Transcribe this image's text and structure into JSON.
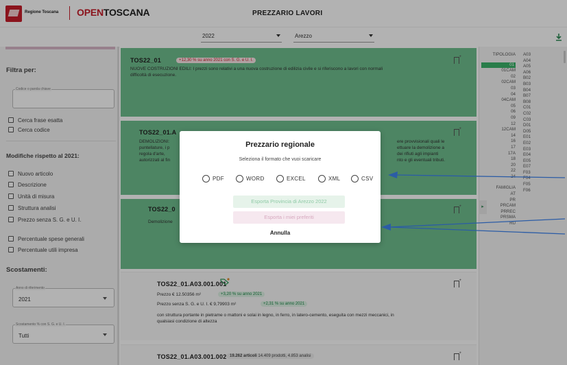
{
  "header": {
    "region": "Regione Toscana",
    "brand_open": "OPEN",
    "brand_tos": "TOSCANA",
    "title": "PREZZARIO LAVORI",
    "year": "2022",
    "province": "Arezzo",
    "download_icon": "download-icon"
  },
  "sidebar": {
    "filter_title": "Filtra per:",
    "search_legend": "Codice o parola chiave",
    "exact_phrase": "Cerca frase esatta",
    "search_code": "Cerca codice",
    "changes_title": "Modifiche rispetto al 2021:",
    "changes": [
      "Nuovo articolo",
      "Descrizione",
      "Unità di misura",
      "Struttura analisi",
      "Prezzo senza S. G. e U. I."
    ],
    "percent": [
      "Percentuale spese generali",
      "Percentuale utili impresa"
    ],
    "deviation_title": "Scostamenti:",
    "ref_year_legend": "Anno di riferimento",
    "ref_year": "2021",
    "deviation_legend": "Scostamento % con S. G. e U. I.",
    "deviation_value": "Tutti"
  },
  "cards": {
    "c1": {
      "code": "TOS22_01",
      "badge": "+12,30 % su anno 2021 con S. G. e U. I.",
      "desc1": "NUOVE COSTRUZIONI EDILI: I prezzi sono relativi a una nuova costruzione di edilizia civile e si riferiscono a lavori con normali",
      "desc2": "difficoltà di esecuzione."
    },
    "c2": {
      "code": "TOS22_01.A",
      "desc_left1": "DEMOLIZIONI:",
      "desc_left2": "puntellature, i p",
      "desc_left3": "regola d'arte, ",
      "desc_left4": "autorizzati al fin",
      "desc_right1": "ere provvisionali quali le",
      "desc_right2": "ettuare la demolizione a",
      "desc_right3": "dei rifiuti agli impianti",
      "desc_right4": "nto e gli eventuali tributi."
    },
    "c3": {
      "code": "TOS22_0",
      "desc": "Demolizione"
    },
    "c4": {
      "code": "TOS22_01.A03.001.001",
      "price": "Prezzo € 12.50356 m²",
      "price_badge": "+3,20 % su anno 2021",
      "price_no": "Prezzo senza S. G. e U. I. € 9,79903 m²",
      "price_no_badge": "+2,31 % su anno 2021",
      "desc1": "con struttura portante in pietrame o mattoni e solai in legno, in ferro, in latero-cemento, eseguita con mezzi meccanici, in",
      "desc2": "qualsiasi condizione di altezza"
    },
    "c5": {
      "code": "TOS22_01.A03.001.002",
      "badge_bold": "19.262 articoli",
      "badge_rest": "14.409 prodotti, 4.853 analisi"
    }
  },
  "rightpanel": {
    "tipologia_label": "TIPOLOGIA",
    "tipologia": [
      "01",
      "01CAM",
      "02",
      "02CAM",
      "03",
      "04",
      "04CAM",
      "05",
      "06",
      "09",
      "12",
      "12CAM",
      "14",
      "16",
      "17",
      "17A",
      "18",
      "20",
      "22",
      "24"
    ],
    "famiglia_label": "FAMIGLIA",
    "famiglia": [
      "AT",
      "PR",
      "PRCAM",
      "PRREC",
      "PRSMA",
      "RU"
    ],
    "codes": [
      "A03",
      "A04",
      "A05",
      "A06",
      "B02",
      "B03",
      "B04",
      "B07",
      "B08",
      "C01",
      "C02",
      "C03",
      "D01",
      "D05",
      "E01",
      "E02",
      "E03",
      "E04",
      "E05",
      "E07",
      "F03",
      "F04",
      "F05",
      "F06"
    ]
  },
  "modal": {
    "title": "Prezzario regionale",
    "subtitle": "Seleziona il formato che vuoi scaricare",
    "formats": [
      "PDF",
      "WORD",
      "EXCEL",
      "XML",
      "CSV"
    ],
    "export_province": "Esporta Provincia di Arezzo 2022",
    "export_favorites": "Esporta i miei preferiti",
    "cancel": "Annulla"
  },
  "colors": {
    "brand_red": "#c81e2a",
    "green": "#6fbf8f",
    "arrow_blue": "#2b5ca6"
  }
}
